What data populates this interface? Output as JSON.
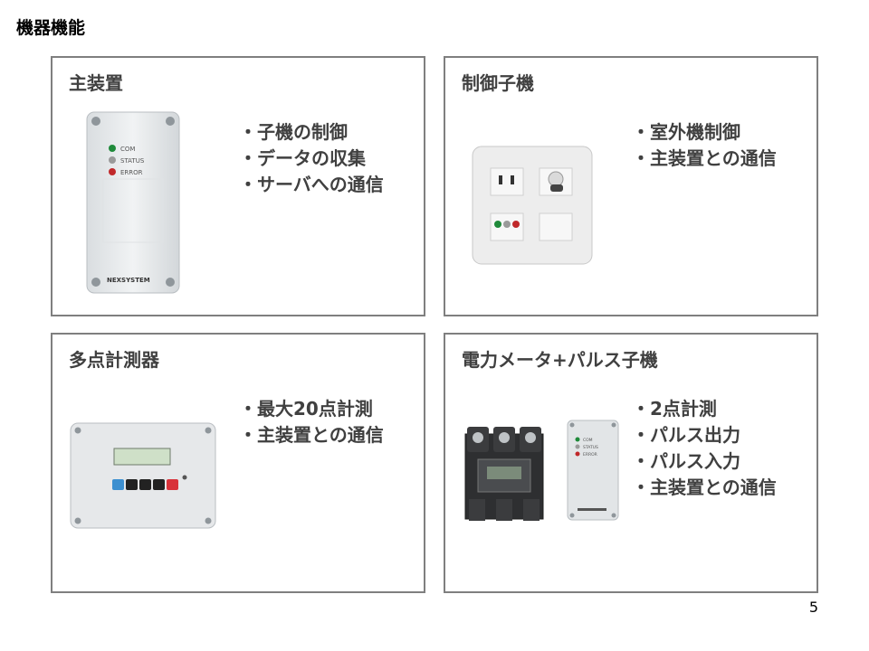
{
  "slide": {
    "title": "機器機能",
    "page_number": "5"
  },
  "panels": [
    {
      "title": "主装置",
      "bullets": [
        "・子機の制御",
        "・データの収集",
        "・サーバへの通信"
      ],
      "device": {
        "leds": [
          {
            "label": "COM",
            "color": "#1f8a3a"
          },
          {
            "label": "STATUS",
            "color": "#9a9a9a"
          },
          {
            "label": "ERROR",
            "color": "#c0282a"
          }
        ],
        "brand": "NEXSYSTEM"
      }
    },
    {
      "title": "制御子機",
      "bullets": [
        "・室外機制御",
        "・主装置との通信"
      ],
      "device": {
        "leds": [
          {
            "color": "#1f8a3a"
          },
          {
            "color": "#9a9a9a"
          },
          {
            "color": "#c0282a"
          }
        ]
      }
    },
    {
      "title": "多点計測器",
      "bullets": [
        "・最大20点計測",
        "・主装置との通信"
      ],
      "device": {
        "buttons": [
          {
            "color": "#3c8fd0"
          },
          {
            "color": "#222222"
          },
          {
            "color": "#222222"
          },
          {
            "color": "#222222"
          },
          {
            "color": "#d8323a"
          }
        ]
      }
    },
    {
      "title": "電力メータ+パルス子機",
      "bullets": [
        "・2点計測",
        "・パルス出力",
        "・パルス入力",
        "・主装置との通信"
      ],
      "device": {
        "leds": [
          {
            "label": "COM",
            "color": "#1f8a3a"
          },
          {
            "label": "STATUS",
            "color": "#9a9a9a"
          },
          {
            "label": "ERROR",
            "color": "#c0282a"
          }
        ]
      }
    }
  ]
}
